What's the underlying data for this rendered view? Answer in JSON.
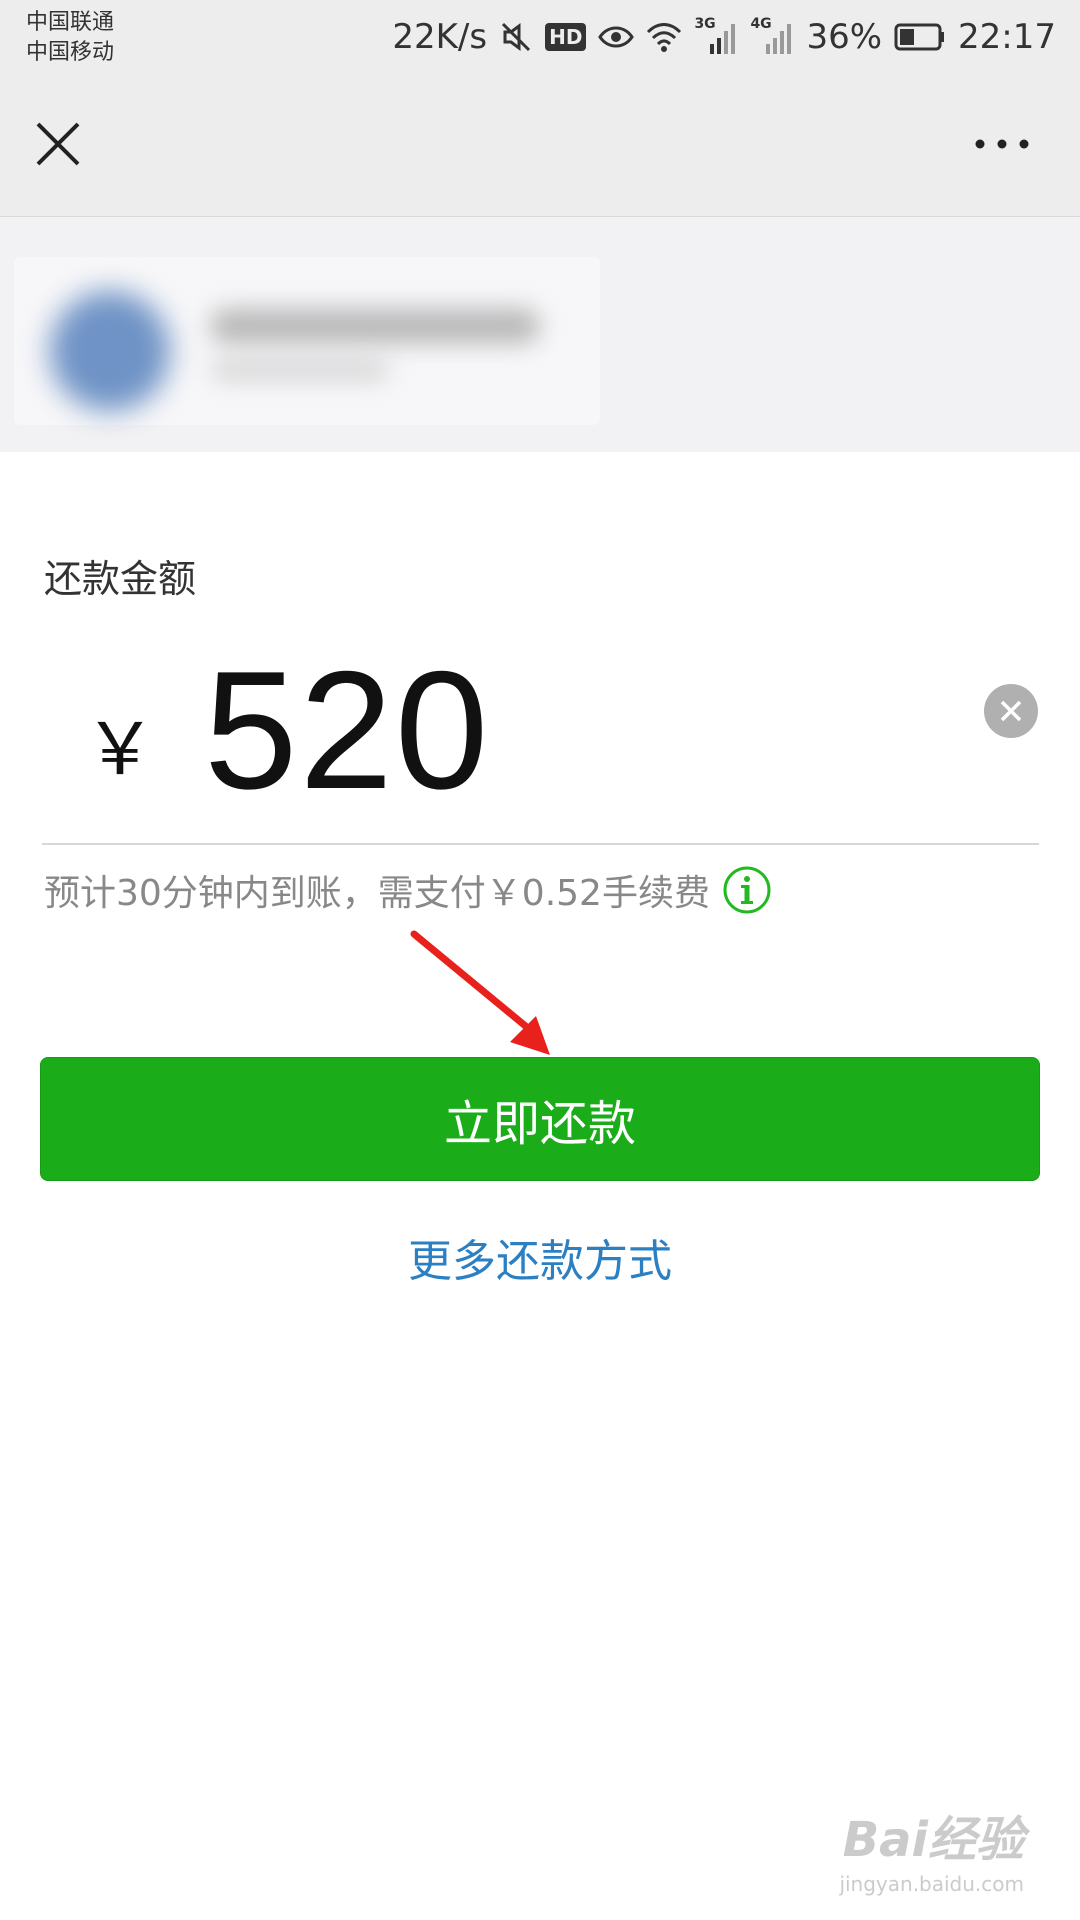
{
  "status_bar": {
    "carrier_1": "中国联通",
    "carrier_2": "中国移动",
    "net_speed": "22K/s",
    "hd_badge": "HD",
    "sig_3g": "3G",
    "sig_4g": "4G",
    "battery": "36%",
    "time": "22:17"
  },
  "amount_section": {
    "label": "还款金额",
    "currency": "￥",
    "amount": "520",
    "fee_note": "预计30分钟内到账，需支付￥0.52手续费"
  },
  "actions": {
    "primary_button": "立即还款",
    "more_methods_link": "更多还款方式"
  },
  "watermark": {
    "logo": "Bai经验",
    "url": "jingyan.baidu.com"
  },
  "icons": {
    "close": "close-icon",
    "more": "more-dots-icon",
    "clear": "clear-icon",
    "info": "info-icon",
    "arrow": "annotation-arrow"
  },
  "colors": {
    "primary_green": "#1aad19",
    "link_blue": "#2b7fc3",
    "info_green": "#22b922",
    "annotation_red": "#e8211d"
  }
}
